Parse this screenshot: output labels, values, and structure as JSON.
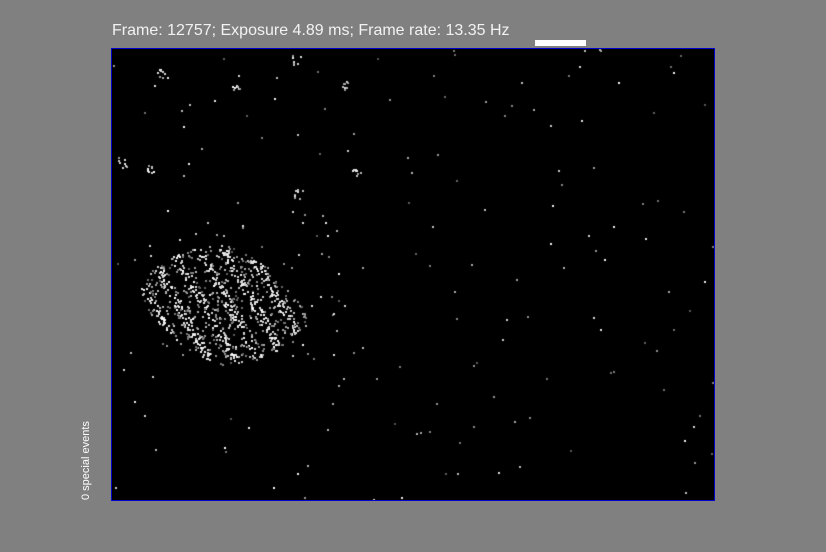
{
  "status_bar": {
    "text": "Frame: 12757; Exposure 4.89 ms; Frame rate: 13.35 Hz",
    "frame": 12757,
    "exposure_ms": 4.89,
    "frame_rate_hz": 13.35
  },
  "side_label": {
    "text": "0 special events"
  },
  "colors": {
    "background": "#808080",
    "viewport_background": "#000000",
    "viewport_border": "#0000cc",
    "text": "#f2f2f2",
    "progress": "#ffffff"
  }
}
